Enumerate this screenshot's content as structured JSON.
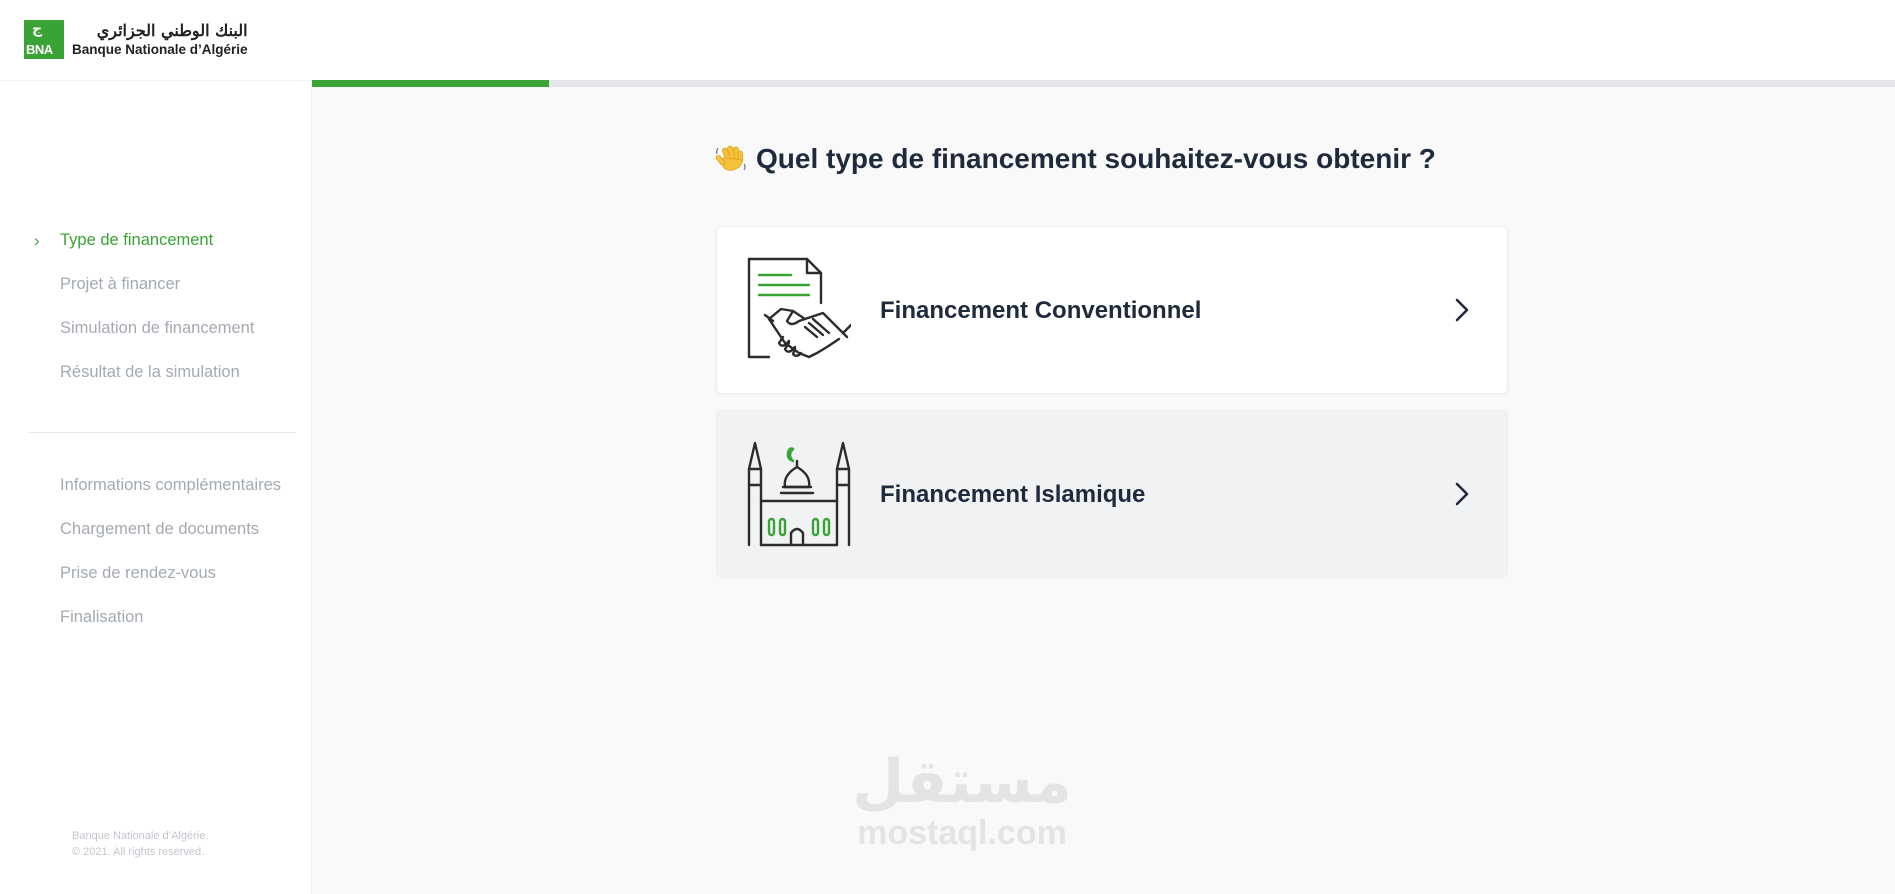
{
  "brand": {
    "logo_glyph": "ج",
    "abbr": "BNA",
    "name_ar": "البنك الوطني الجزائري",
    "name_fr": "Banque Nationale d’Algérie"
  },
  "sidebar": {
    "steps_group_1": [
      {
        "label": "Type de financement",
        "active": true
      },
      {
        "label": "Projet à financer",
        "active": false
      },
      {
        "label": "Simulation de financement",
        "active": false
      },
      {
        "label": "Résultat de la simulation",
        "active": false
      }
    ],
    "steps_group_2": [
      {
        "label": "Informations complémentaires",
        "active": false
      },
      {
        "label": "Chargement de documents",
        "active": false
      },
      {
        "label": "Prise de rendez-vous",
        "active": false
      },
      {
        "label": "Finalisation",
        "active": false
      }
    ],
    "chevron": "›",
    "footer_line1": "Banque Nationale d’Algérie.",
    "footer_line2": "© 2021. All rights reserved."
  },
  "progress": {
    "completed_fraction": 0.15
  },
  "main": {
    "question": "Quel type de financement souhaitez-vous obtenir ?",
    "question_icon": "waving-hand-icon",
    "options": [
      {
        "label": "Financement Conventionnel",
        "icon": "contract-handshake-icon"
      },
      {
        "label": "Financement Islamique",
        "icon": "mosque-icon"
      }
    ]
  },
  "watermark": {
    "arabic": "مستقل",
    "latin": "mostaql.com"
  },
  "colors": {
    "accent": "#3aa335",
    "text_dark": "#1f2a3c",
    "text_muted": "#a4aab2",
    "background_main": "#f9f9f9"
  }
}
